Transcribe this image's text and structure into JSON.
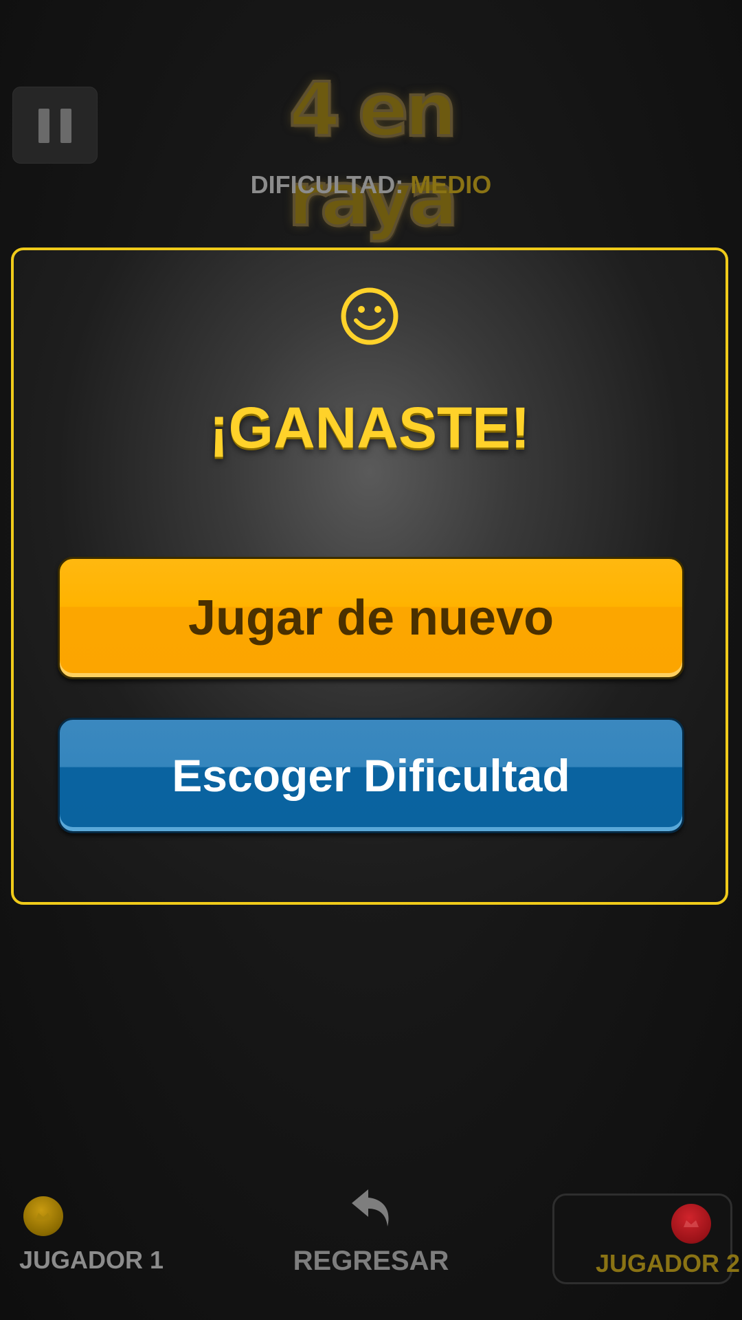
{
  "header": {
    "logo_text": "4 en raya",
    "difficulty_label": "DIFICULTAD:",
    "difficulty_value": "MEDIO"
  },
  "dialog": {
    "result_title": "¡GANASTE!",
    "play_again_label": "Jugar de nuevo",
    "choose_difficulty_label": "Escoger Dificultad"
  },
  "footer": {
    "player1_label": "JUGADOR 1",
    "back_label": "REGRESAR",
    "player2_label": "JUGADOR 2"
  },
  "icons": {
    "pause": "pause-icon",
    "smiley": "smiley-icon",
    "back": "undo-arrow-icon",
    "player1_chip": "yellow-chip-icon",
    "player2_chip": "red-chip-icon"
  },
  "colors": {
    "accent_yellow": "#f0cb1a",
    "play_button": "#fcaa00",
    "difficulty_button": "#0a63a0",
    "difficulty_value": "#8a7314"
  }
}
